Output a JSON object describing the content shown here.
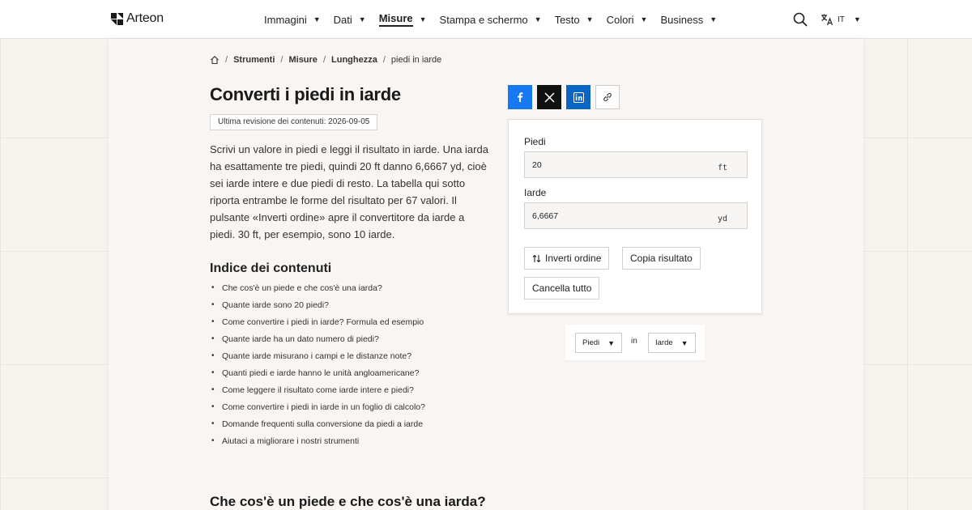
{
  "brand": {
    "name": "Arteon"
  },
  "nav": {
    "items": [
      {
        "label": "Immagini"
      },
      {
        "label": "Dati"
      },
      {
        "label": "Misure",
        "active": true
      },
      {
        "label": "Stampa e schermo"
      },
      {
        "label": "Testo"
      },
      {
        "label": "Colori"
      },
      {
        "label": "Business"
      }
    ],
    "caret": "▼"
  },
  "header": {
    "search_icon": "search-icon",
    "language": "IT",
    "language_icon": "translate-icon"
  },
  "breadcrumb": [
    "Strumenti",
    "Misure",
    "Lunghezza"
  ],
  "breadcrumb_current": "piedi in iarde",
  "page": {
    "title": "Converti i piedi in iarde",
    "revision": "Ultima revisione dei contenuti: 2026-09-05",
    "intro": "Scrivi un valore in piedi e leggi il risultato in iarde. Una iarda ha esattamente tre piedi, quindi 20 ft danno 6,6667 yd, cioè sei iarde intere e due piedi di resto. La tabella qui sotto riporta entrambe le forme del risultato per 67 valori. Il pulsante «Inverti ordine» apre il convertitore da iarde a piedi. 30 ft, per esempio, sono 10 iarde.",
    "toc_title": "Indice dei contenuti",
    "toc": [
      "Che cos'è un piede e che cos'è una iarda?",
      "Quante iarde sono 20 piedi?",
      "Come convertire i piedi in iarde? Formula ed esempio",
      "Quante iarde ha un dato numero di piedi?",
      "Quante iarde misurano i campi e le distanze note?",
      "Quanti piedi e iarde hanno le unità angloamericane?",
      "Come leggere il risultato come iarde intere e piedi?",
      "Come convertire i piedi in iarde in un foglio di calcolo?",
      "Domande frequenti sulla conversione da piedi a iarde",
      "Aiutaci a migliorare i nostri strumenti"
    ],
    "section_title": "Che cos'è un piede e che cos'è una iarda?"
  },
  "share": [
    "facebook-icon",
    "x-icon",
    "linkedin-icon",
    "link-icon"
  ],
  "converter": {
    "from_label": "Piedi",
    "from_value": "20",
    "from_unit": "ft",
    "to_label": "Iarde",
    "to_value": "6,6667",
    "to_unit": "yd",
    "swap_label": "Inverti ordine",
    "copy_label": "Copia risultato",
    "clear_label": "Cancella tutto"
  },
  "unit_select": {
    "from": "Piedi",
    "connector": "in",
    "to": "Iarde"
  },
  "colors": {
    "facebook": "#1877f2",
    "x": "#111111",
    "linkedin": "#0a66c2",
    "accent": "#222222"
  }
}
